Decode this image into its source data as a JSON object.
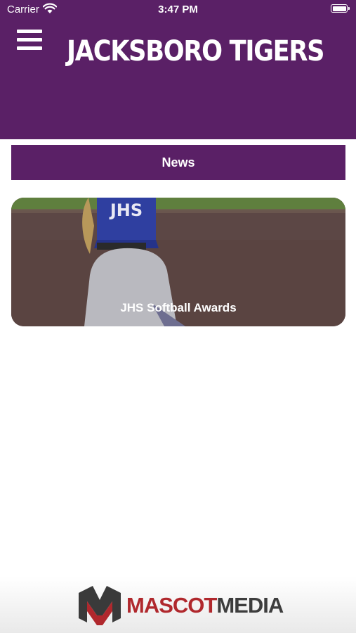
{
  "status_bar": {
    "carrier": "Carrier",
    "time": "3:47 PM"
  },
  "header": {
    "brand": "JACKSBORO TIGERS",
    "menu_icon": "hamburger-menu-icon"
  },
  "section": {
    "title": "News"
  },
  "news": {
    "items": [
      {
        "title": "JHS Softball Awards",
        "jersey_text": "JHS"
      }
    ]
  },
  "footer": {
    "brand_part1": "MASCOT",
    "brand_part2": "MEDIA"
  },
  "colors": {
    "primary": "#5a2066",
    "footer_red": "#b0282d",
    "footer_dark": "#3d3d3d"
  }
}
